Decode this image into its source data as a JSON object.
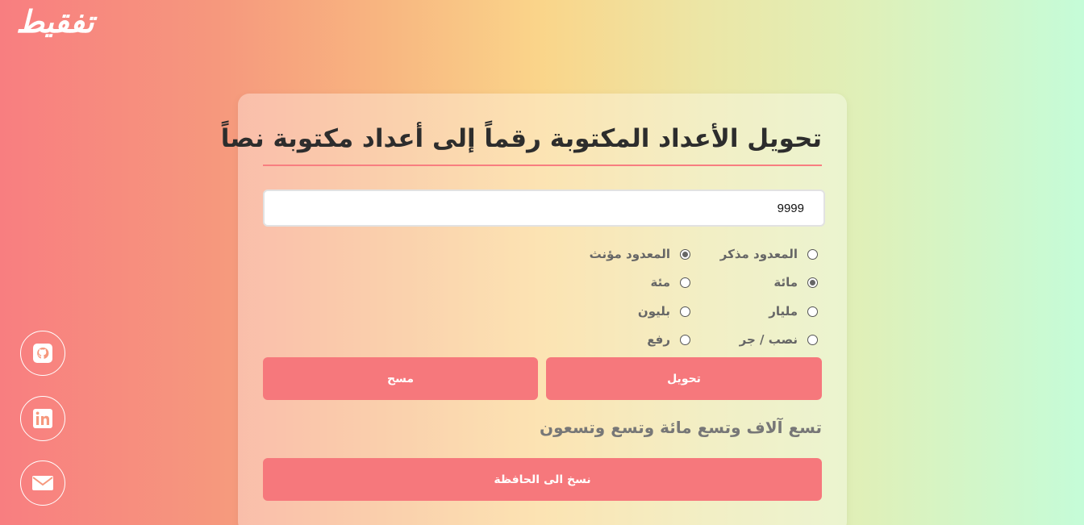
{
  "brand": {
    "logo_text": "تفقيط"
  },
  "social": [
    {
      "icon": "github-icon"
    },
    {
      "icon": "linkedin-icon"
    },
    {
      "icon": "mail-icon"
    }
  ],
  "converter": {
    "title": "تحويل الأعداد المكتوبة رقماً إلى أعداد مكتوبة نصاً",
    "input_value": "9999",
    "options": {
      "masculine": {
        "label": "المعدود مذكر",
        "checked": false
      },
      "feminine": {
        "label": "المعدود مؤنث",
        "checked": true
      },
      "mia_alef": {
        "label": "مائة",
        "checked": true
      },
      "mia": {
        "label": "مئة",
        "checked": false
      },
      "milyar": {
        "label": "مليار",
        "checked": false
      },
      "bilyon": {
        "label": "بليون",
        "checked": false
      },
      "nasb_jar": {
        "label": "نصب / جر",
        "checked": false
      },
      "raf": {
        "label": "رفع",
        "checked": false
      }
    },
    "convert_label": "تحويل",
    "clear_label": "مسح",
    "result_text": "تسع آلاف وتسع مائة وتسع وتسعون",
    "copy_label": "نسخ الى الحافظة"
  },
  "colors": {
    "accent": "#f6787c",
    "underline": "#f87e80"
  }
}
